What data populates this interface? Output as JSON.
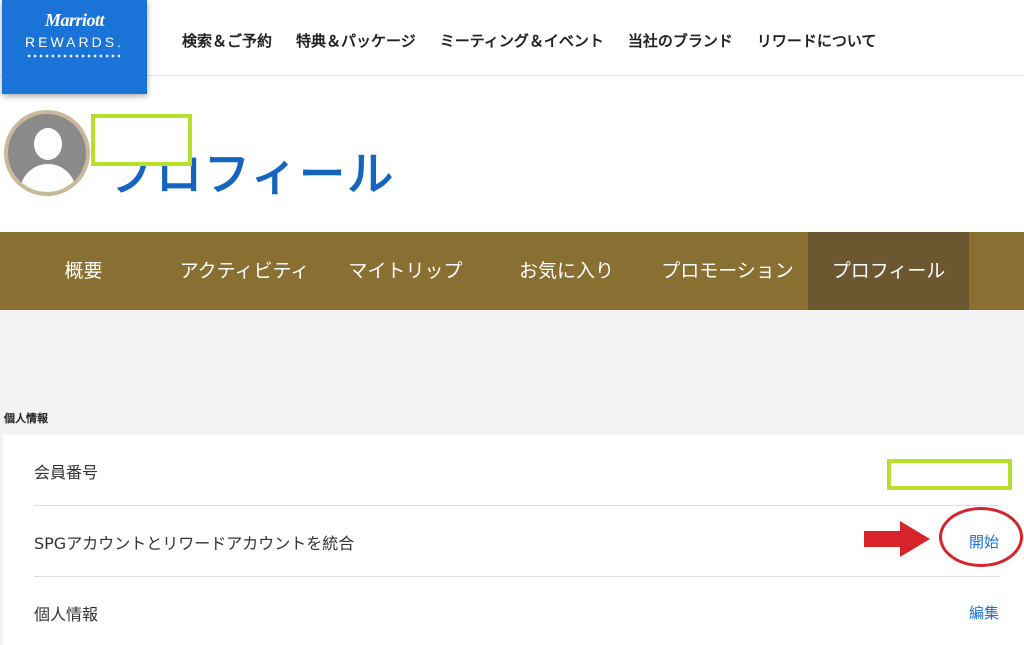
{
  "logo": {
    "brand": "Marriott",
    "rewards": "REWARDS."
  },
  "topnav": [
    "検索＆ご予約",
    "特典＆パッケージ",
    "ミーティング＆イベント",
    "当社のブランド",
    "リワードについて"
  ],
  "page_title": "プロフィール",
  "tabs": [
    {
      "label": "概要"
    },
    {
      "label": "アクティビティ"
    },
    {
      "label": "マイトリップ"
    },
    {
      "label": "お気に入り"
    },
    {
      "label": "プロモーション"
    },
    {
      "label": "プロフィール",
      "active": true
    }
  ],
  "section_label": "個人情報",
  "rows": [
    {
      "label": "会員番号",
      "action": ""
    },
    {
      "label": "SPGアカウントとリワードアカウントを統合",
      "action": "開始"
    },
    {
      "label": "個人情報",
      "action": "編集"
    }
  ],
  "colors": {
    "brand_blue": "#1a73d6",
    "tab_gold": "#8a6f33",
    "tab_active": "#6c5730",
    "redaction": "#b6e02a",
    "annotation_red": "#d8232a"
  }
}
